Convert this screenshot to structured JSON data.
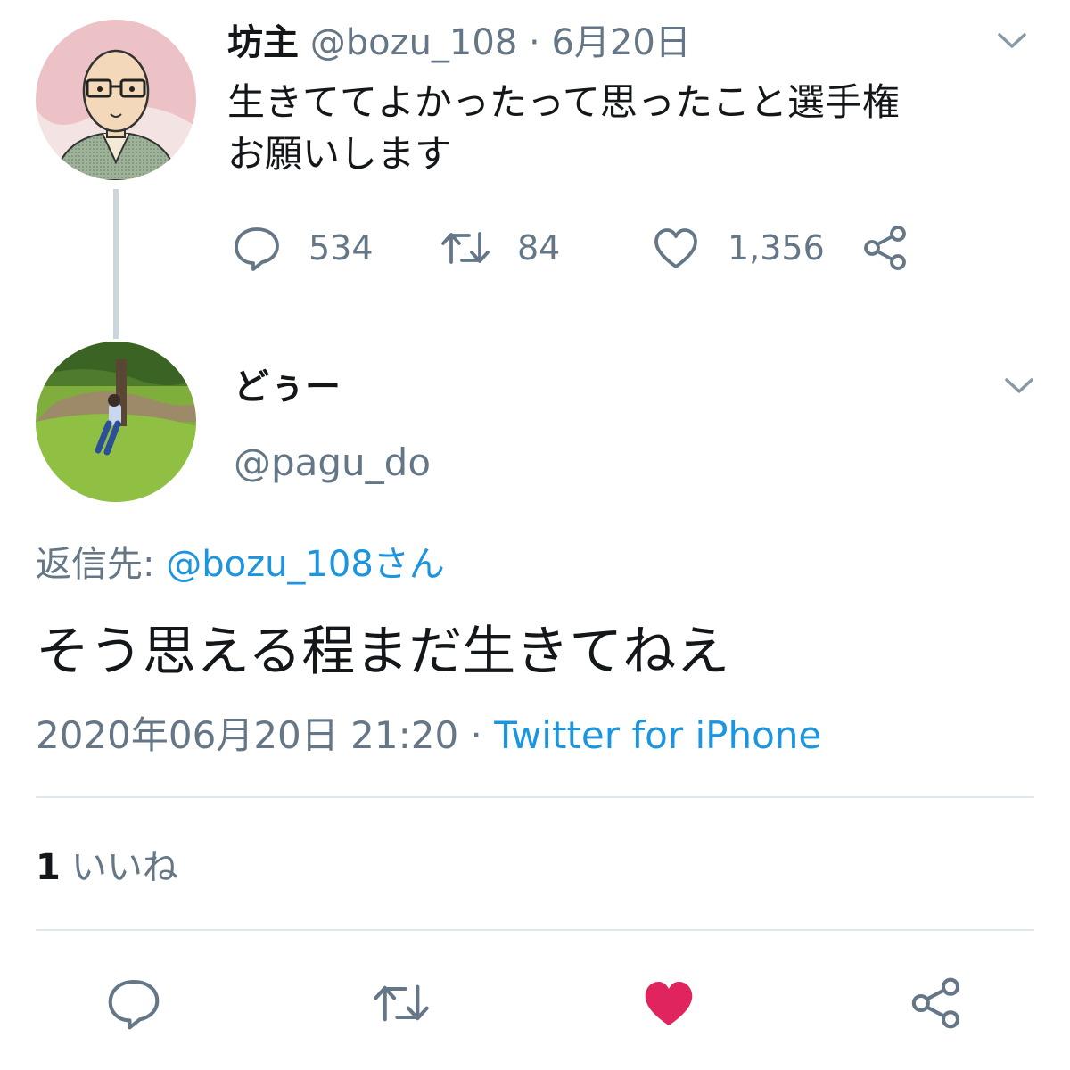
{
  "parent_tweet": {
    "display_name": "坊主",
    "handle": "@bozu_108",
    "separator": "·",
    "date": "6月20日",
    "text_lines": [
      "生きててよかったって思ったこと選手権",
      "お願いします"
    ],
    "reply_count": "534",
    "retweet_count": "84",
    "like_count": "1,356"
  },
  "reply_tweet": {
    "display_name": "どぅー",
    "handle": "@pagu_do",
    "reply_to_label": "返信先:",
    "reply_to_handle": "@bozu_108さん",
    "text": "そう思える程まだ生きてねえ",
    "timestamp": "2020年06月20日 21:20",
    "separator": "·",
    "source": "Twitter for iPhone",
    "likes_number": "1",
    "likes_label": "いいね"
  },
  "icons": {
    "reply": "reply-icon",
    "retweet": "retweet-icon",
    "like": "heart-icon",
    "share": "share-icon",
    "menu": "chevron-down-icon"
  },
  "colors": {
    "accent": "#1b95e0",
    "muted": "#657786",
    "liked": "#e0245e",
    "divider": "#e1e8ed"
  }
}
